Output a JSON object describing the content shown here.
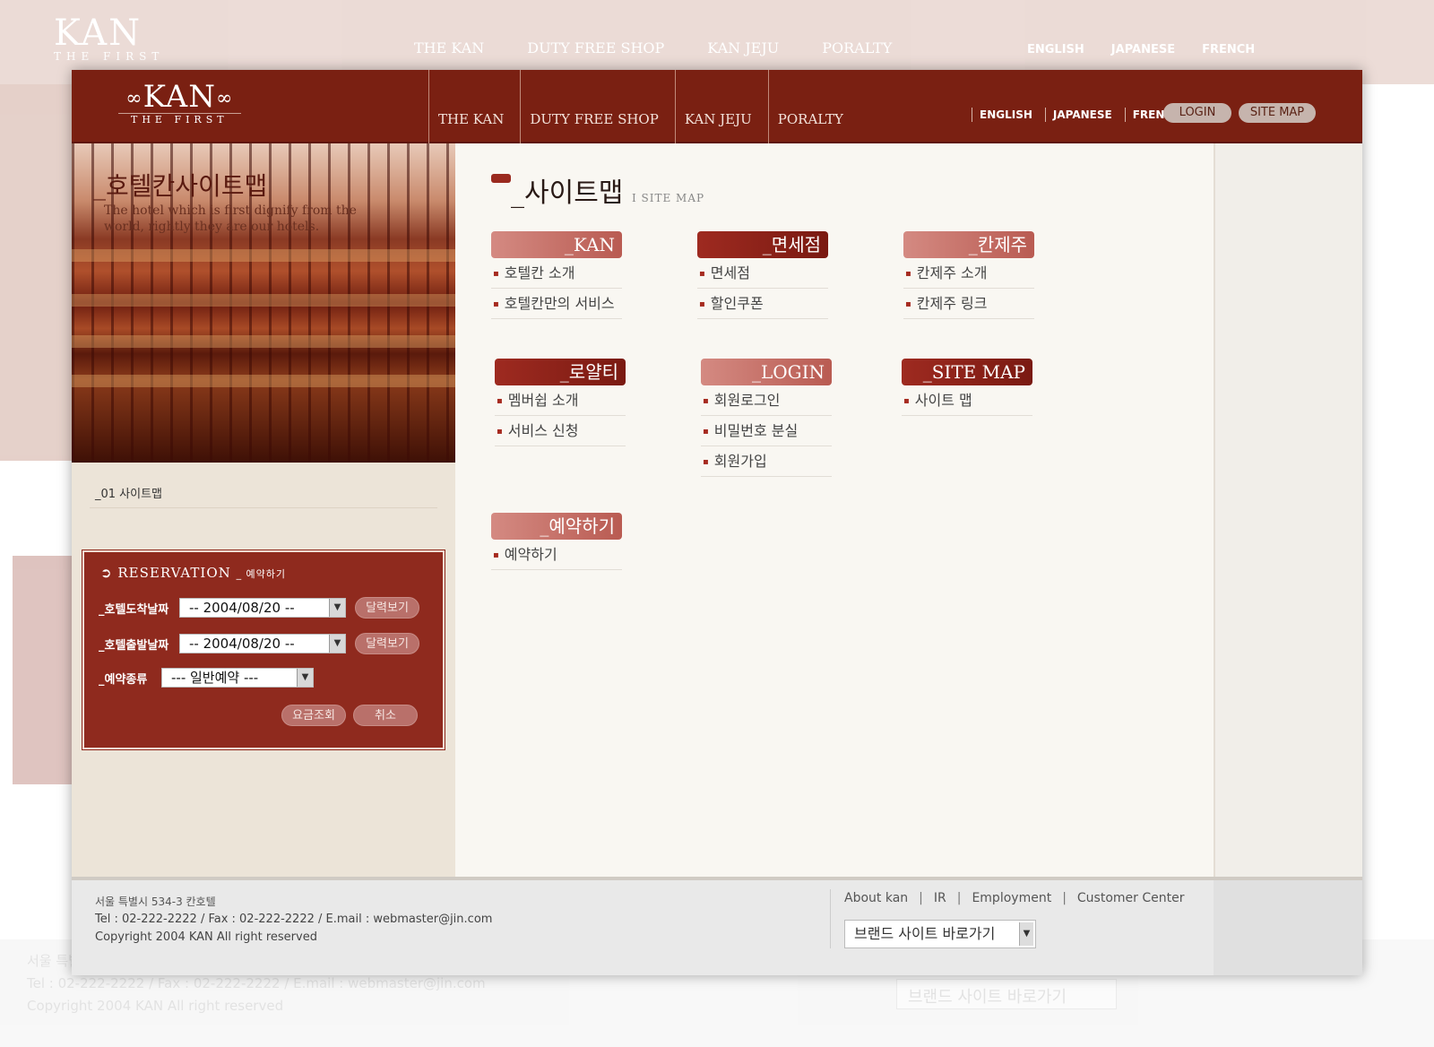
{
  "header": {
    "logo": "KAN",
    "logo_sub": "THE FIRST",
    "nav": [
      "THE KAN",
      "DUTY FREE SHOP",
      "KAN JEJU",
      "PORALTY"
    ],
    "languages": [
      "ENGLISH",
      "JAPANESE",
      "FRENCH"
    ],
    "login": "LOGIN",
    "sitemap": "SITE MAP"
  },
  "hero": {
    "title": "_호텔칸사이트맵",
    "subtitle": "The hotel which is first dignify from the world, rightly they are our hotels."
  },
  "breadcrumb": "_01 사이트맵",
  "reservation": {
    "title": "RESERVATION",
    "title_ko": "_ 예약하기",
    "arrival_label": "_호텔도착날짜",
    "arrival_value": "-- 2004/08/20 --",
    "departure_label": "_호텔출발날짜",
    "departure_value": "-- 2004/08/20 --",
    "calendar_btn": "달력보기",
    "type_label": "_예약종류",
    "type_value": "--- 일반예약 ---",
    "search_btn": "요금조회",
    "cancel_btn": "취소"
  },
  "sitemap": {
    "title": "_사이트맵",
    "title_en": "I SITE MAP",
    "categories": [
      {
        "head": "_KAN",
        "items": [
          "호텔칸 소개",
          "호텔칸만의 서비스"
        ]
      },
      {
        "head": "_면세점",
        "items": [
          "면세점",
          "할인쿠폰"
        ]
      },
      {
        "head": "_칸제주",
        "items": [
          "칸제주 소개",
          "칸제주 링크"
        ]
      },
      {
        "head": "_로얄티",
        "items": [
          "멤버쉽 소개",
          "서비스 신청"
        ]
      },
      {
        "head": "_LOGIN",
        "items": [
          "회원로그인",
          "비밀번호 분실",
          "회원가입"
        ]
      },
      {
        "head": "_SITE MAP",
        "items": [
          "사이트 맵"
        ]
      },
      {
        "head": "_예약하기",
        "items": [
          "예약하기"
        ]
      }
    ]
  },
  "footer": {
    "address": "서울 특별시 534-3 칸호텔",
    "contact": "Tel : 02-222-2222  / Fax : 02-222-2222 /  E.mail : webmaster@jin.com",
    "copyright": "Copyright 2004 KAN All right reserved",
    "links": [
      "About kan",
      "IR",
      "Employment",
      "Customer Center"
    ],
    "brand_select": "브랜드 사이트 바로가기"
  },
  "colors": {
    "brand": "#7a2012",
    "accent": "#9e2a20",
    "accent_light": "#d48a82"
  }
}
